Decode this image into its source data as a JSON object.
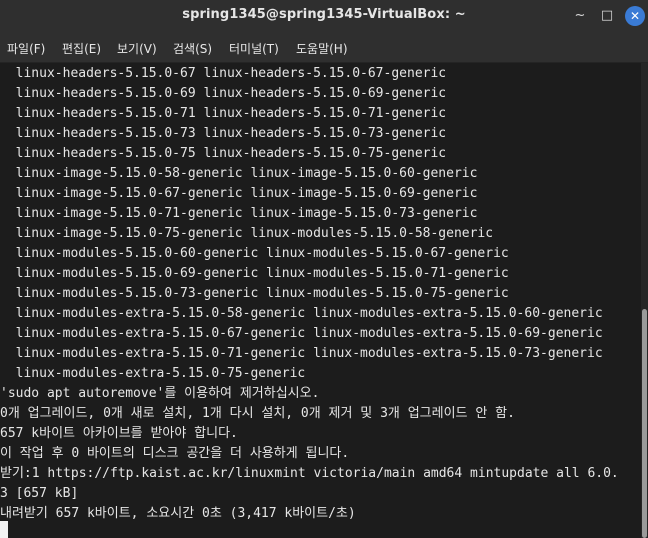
{
  "window": {
    "title": "spring1345@spring1345-VirtualBox: ~",
    "minimize_glyph": "~",
    "maximize_glyph": "□",
    "close_glyph": "✕"
  },
  "menu": [
    "파일(F)",
    "편집(E)",
    "보기(V)",
    "검색(S)",
    "터미널(T)",
    "도움말(H)"
  ],
  "terminal": {
    "lines": [
      "  linux-headers-5.15.0-67 linux-headers-5.15.0-67-generic",
      "  linux-headers-5.15.0-69 linux-headers-5.15.0-69-generic",
      "  linux-headers-5.15.0-71 linux-headers-5.15.0-71-generic",
      "  linux-headers-5.15.0-73 linux-headers-5.15.0-73-generic",
      "  linux-headers-5.15.0-75 linux-headers-5.15.0-75-generic",
      "  linux-image-5.15.0-58-generic linux-image-5.15.0-60-generic",
      "  linux-image-5.15.0-67-generic linux-image-5.15.0-69-generic",
      "  linux-image-5.15.0-71-generic linux-image-5.15.0-73-generic",
      "  linux-image-5.15.0-75-generic linux-modules-5.15.0-58-generic",
      "  linux-modules-5.15.0-60-generic linux-modules-5.15.0-67-generic",
      "  linux-modules-5.15.0-69-generic linux-modules-5.15.0-71-generic",
      "  linux-modules-5.15.0-73-generic linux-modules-5.15.0-75-generic",
      "  linux-modules-extra-5.15.0-58-generic linux-modules-extra-5.15.0-60-generic",
      "  linux-modules-extra-5.15.0-67-generic linux-modules-extra-5.15.0-69-generic",
      "  linux-modules-extra-5.15.0-71-generic linux-modules-extra-5.15.0-73-generic",
      "  linux-modules-extra-5.15.0-75-generic",
      "'sudo apt autoremove'를 이용하여 제거하십시오.",
      "0개 업그레이드, 0개 새로 설치, 1개 다시 설치, 0개 제거 및 3개 업그레이드 안 함.",
      "657 k바이트 아카이브를 받아야 합니다.",
      "이 작업 후 0 바이트의 디스크 공간을 더 사용하게 됩니다.",
      "받기:1 https://ftp.kaist.ac.kr/linuxmint victoria/main amd64 mintupdate all 6.0.",
      "3 [657 kB]",
      "내려받기 657 k바이트, 소요시간 0초 (3,417 k바이트/초)"
    ]
  }
}
